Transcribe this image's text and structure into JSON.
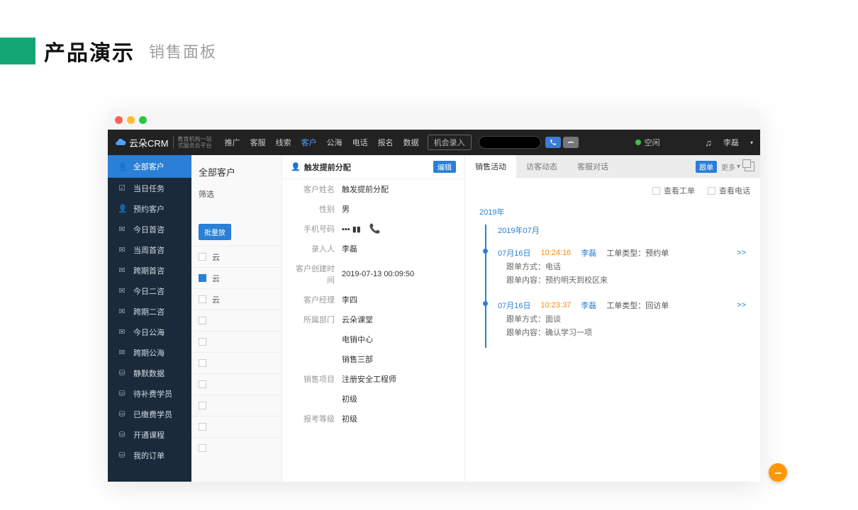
{
  "page": {
    "title_main": "产品演示",
    "title_sub": "销售面板"
  },
  "topnav": {
    "logo_text": "云朵CRM",
    "logo_tag_line1": "教育机构一站",
    "logo_tag_line2": "式服务云平台",
    "items": [
      "推广",
      "客服",
      "线索",
      "客户",
      "公海",
      "电话",
      "报名",
      "数据"
    ],
    "active_index": 3,
    "opportunity_label": "机会录入",
    "status_label": "空闲",
    "user_name": "李磊"
  },
  "sidebar": {
    "head": "全部客户",
    "items": [
      {
        "icon": "☑",
        "label": "当日任务"
      },
      {
        "icon": "👤",
        "label": "预约客户"
      },
      {
        "icon": "✉",
        "label": "今日首咨"
      },
      {
        "icon": "✉",
        "label": "当周首咨"
      },
      {
        "icon": "✉",
        "label": "跨期首咨"
      },
      {
        "icon": "✉",
        "label": "今日二咨"
      },
      {
        "icon": "✉",
        "label": "跨期二咨"
      },
      {
        "icon": "✉",
        "label": "今日公海"
      },
      {
        "icon": "✉",
        "label": "跨期公海"
      },
      {
        "icon": "⛁",
        "label": "静默数据"
      },
      {
        "icon": "⛁",
        "label": "待补费学员"
      },
      {
        "icon": "⛁",
        "label": "已缴费学员"
      },
      {
        "icon": "⛁",
        "label": "开通课程"
      },
      {
        "icon": "⛁",
        "label": "我的订单"
      }
    ]
  },
  "mid": {
    "title": "全部客户",
    "filter_label": "筛选",
    "batch_btn": "批量放",
    "rows": [
      "云",
      "云",
      "云",
      "",
      "",
      "",
      "",
      "",
      "",
      ""
    ]
  },
  "detail": {
    "header_title": "触发提前分配",
    "edit_btn": "编辑",
    "fields": [
      {
        "label": "客户姓名",
        "value": "触发提前分配"
      },
      {
        "label": "性别",
        "value": "男"
      },
      {
        "label": "手机号码",
        "value": "▪▪▪ ▮▮"
      },
      {
        "label": "录入人",
        "value": "李磊"
      },
      {
        "label": "客户创建时间",
        "value": "2019-07-13 00:09:50"
      },
      {
        "label": "客户经理",
        "value": "李四"
      },
      {
        "label": "所属部门",
        "value": "云朵课堂"
      },
      {
        "label": "",
        "value": "电销中心"
      },
      {
        "label": "",
        "value": "销售三部"
      },
      {
        "label": "销售项目",
        "value": "注册安全工程师"
      },
      {
        "label": "",
        "value": "初级"
      },
      {
        "label": "报考等级",
        "value": "初级"
      }
    ]
  },
  "activity": {
    "tabs": [
      "销售活动",
      "访客动态",
      "客服对话"
    ],
    "active_tab": 0,
    "tag_btn": "跟单",
    "more_btn": "更多",
    "filters": [
      {
        "label": "查看工单"
      },
      {
        "label": "查看电话"
      }
    ],
    "year": "2019年",
    "month": "2019年07月",
    "entries": [
      {
        "date": "07月16日",
        "time": "10:24:16",
        "name": "李磊",
        "type_label": "工单类型：",
        "type_value": "预约单",
        "more": ">>",
        "rows": [
          {
            "k": "跟单方式：",
            "v": "电话"
          },
          {
            "k": "跟单内容：",
            "v": "预约明天到校区来"
          }
        ]
      },
      {
        "date": "07月16日",
        "time": "10:23:37",
        "name": "李磊",
        "type_label": "工单类型：",
        "type_value": "回访单",
        "more": ">>",
        "rows": [
          {
            "k": "跟单方式：",
            "v": "面谈"
          },
          {
            "k": "跟单内容：",
            "v": "确认学习一项"
          }
        ]
      }
    ]
  }
}
